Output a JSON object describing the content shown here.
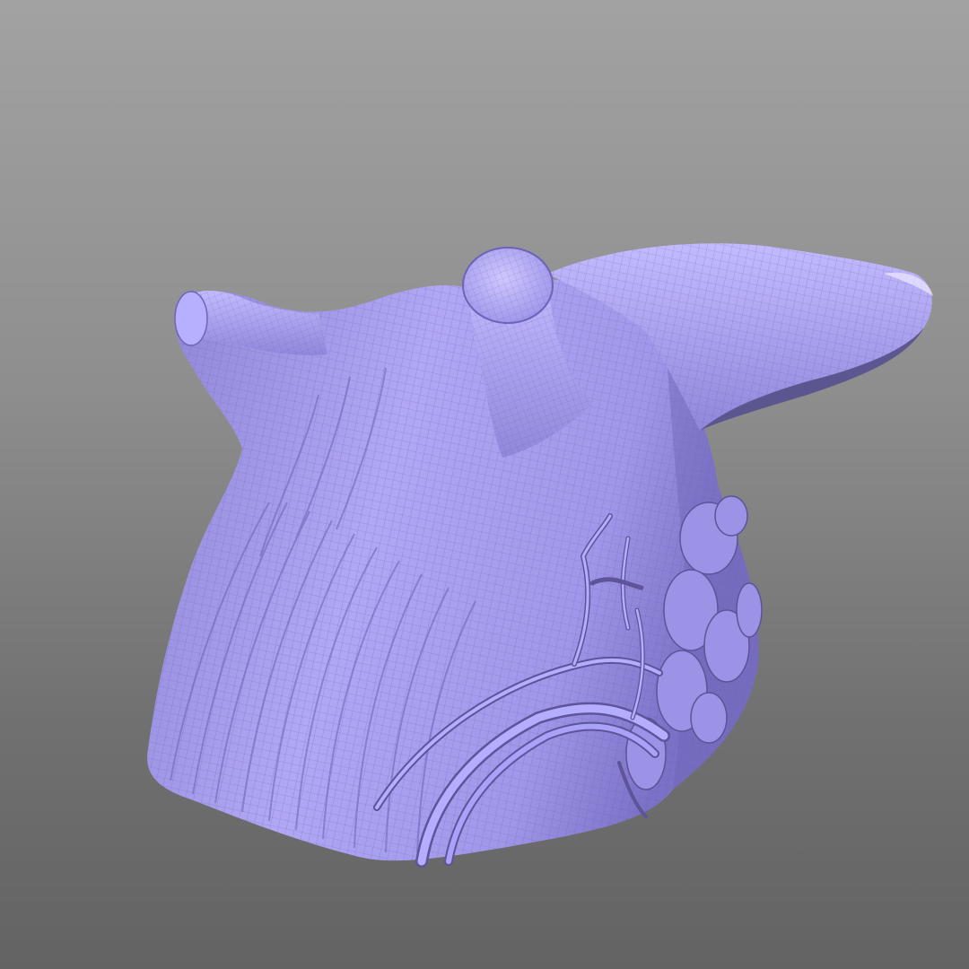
{
  "viewport": {
    "background_top": "#a2a2a2",
    "background_bottom": "#636363"
  },
  "model": {
    "surface_color": "#a89ef0",
    "highlight_color": "#c9c2ff",
    "shadow_color": "#6d63b8",
    "wire_color": "#5e5598",
    "display_mode": "wireframe-on-shaded"
  }
}
